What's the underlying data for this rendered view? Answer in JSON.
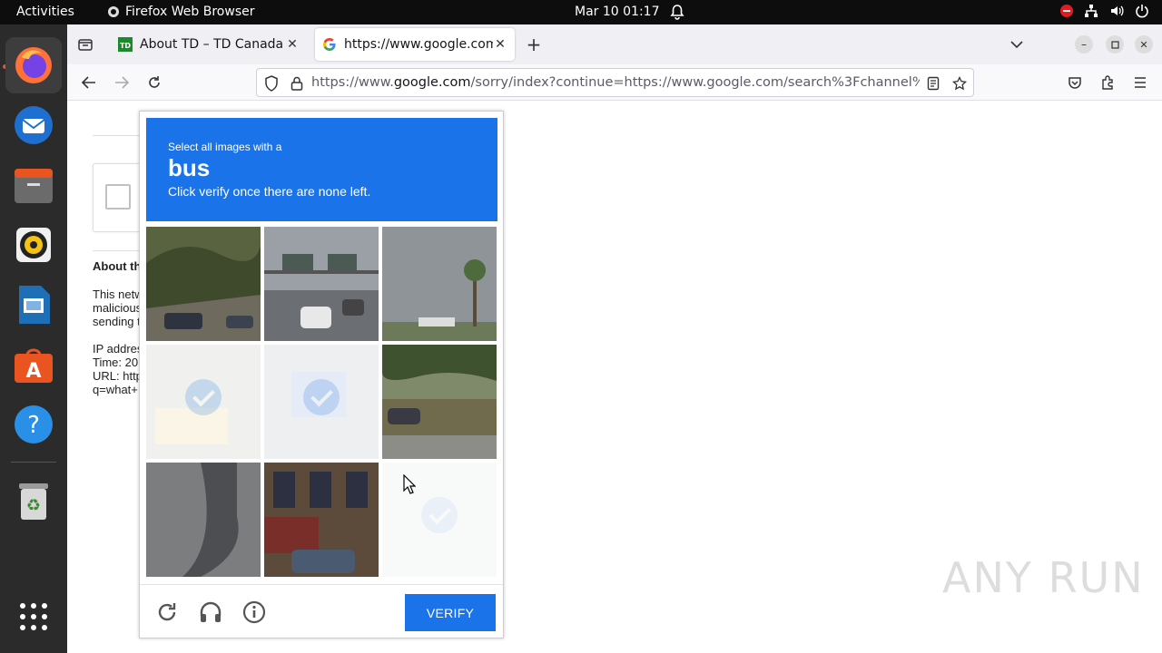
{
  "system": {
    "activities": "Activities",
    "app_name": "Firefox Web Browser",
    "datetime": "Mar 10  01:17"
  },
  "dock": {
    "items": [
      "firefox",
      "thunderbird",
      "files",
      "rhythmbox",
      "libreoffice-impress",
      "app-center",
      "help",
      "trash",
      "show-apps"
    ]
  },
  "browser": {
    "tabs": [
      {
        "title": "About TD – TD Canada Tr",
        "active": false
      },
      {
        "title": "https://www.google.com/",
        "active": true
      }
    ],
    "url_prefix": "https://www.",
    "url_host": "google.com",
    "url_path": "/sorry/index?continue=https://www.google.com/search%3Fchannel%3"
  },
  "page": {
    "about_heading": "About th",
    "lines": [
      "This netw",
      "malicious",
      "sending t",
      "IP addres",
      "Time: 20",
      "URL: http",
      "q=what+"
    ]
  },
  "captcha": {
    "instruction_small": "Select all images with a",
    "target": "bus",
    "instruction_sub": "Click verify once there are none left.",
    "verify_label": "VERIFY",
    "tiles": [
      {
        "selected": false
      },
      {
        "selected": false
      },
      {
        "selected": false
      },
      {
        "selected": true
      },
      {
        "selected": true
      },
      {
        "selected": false
      },
      {
        "selected": false
      },
      {
        "selected": false
      },
      {
        "selected": true
      }
    ]
  },
  "watermark": "ANY  RUN"
}
